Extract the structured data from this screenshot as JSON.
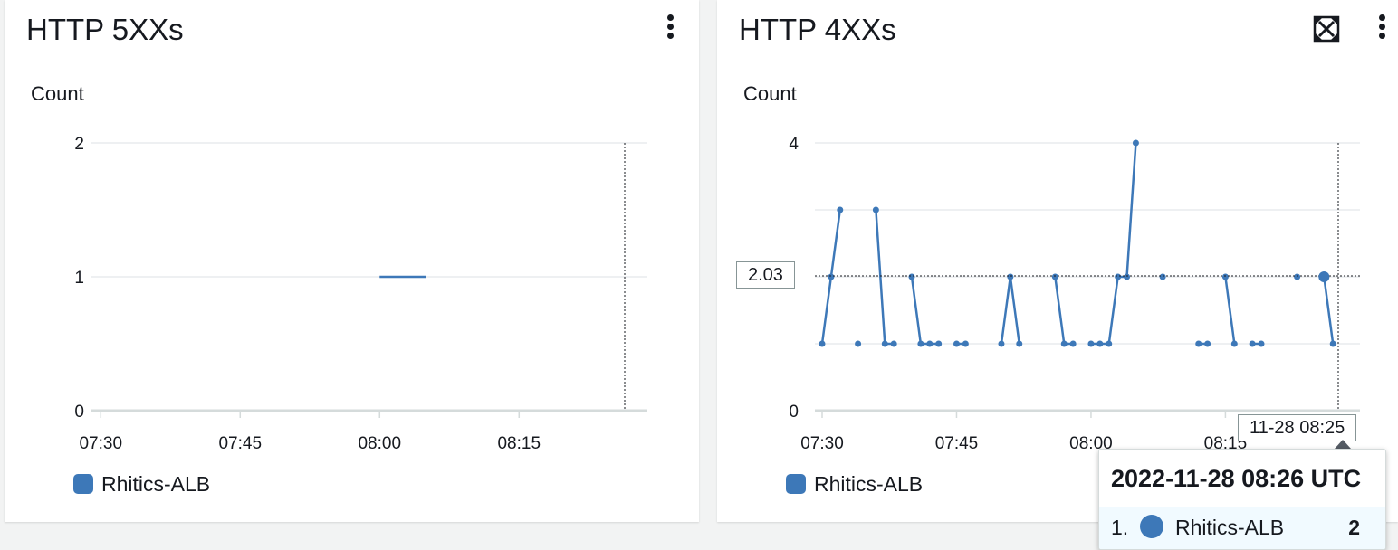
{
  "colors": {
    "series": "#3d78b8",
    "grid": "#e9ebed",
    "axis": "#d5dbdb"
  },
  "widgets": [
    {
      "title": "HTTP 5XXs",
      "y_unit": "Count",
      "menu_icon": "more-vertical-icon",
      "legend": "Rhitics-ALB"
    },
    {
      "title": "HTTP 4XXs",
      "y_unit": "Count",
      "menu_icon": "more-vertical-icon",
      "expand_icon": "expand-icon",
      "legend": "Rhitics-ALB",
      "crosshair": {
        "y_value_label": "2.03",
        "x_time_label": "11-28 08:25"
      },
      "tooltip": {
        "title": "2022-11-28 08:26 UTC",
        "rows": [
          {
            "index": "1.",
            "name": "Rhitics-ALB",
            "value": "2"
          }
        ]
      }
    }
  ],
  "chart_data": [
    {
      "type": "line",
      "title": "HTTP 5XXs",
      "ylabel": "Count",
      "ylim": [
        0,
        2
      ],
      "y_ticks": [
        "0",
        "1",
        "2"
      ],
      "x_ticks": [
        "07:30",
        "07:45",
        "08:00",
        "08:15"
      ],
      "xlim": [
        "07:29",
        "08:29"
      ],
      "series": [
        {
          "name": "Rhitics-ALB",
          "points": [
            {
              "t": "08:00",
              "v": 1
            },
            {
              "t": "08:05",
              "v": 1
            }
          ]
        }
      ]
    },
    {
      "type": "line",
      "title": "HTTP 4XXs",
      "ylabel": "Count",
      "ylim": [
        0,
        4
      ],
      "y_ticks": [
        "0",
        "4"
      ],
      "x_ticks": [
        "07:30",
        "07:45",
        "08:00",
        "08:15"
      ],
      "xlim": [
        "07:30",
        "08:29"
      ],
      "series": [
        {
          "name": "Rhitics-ALB",
          "segments": [
            [
              {
                "t": "07:30",
                "v": 1
              },
              {
                "t": "07:31",
                "v": 2
              },
              {
                "t": "07:32",
                "v": 3
              }
            ],
            [
              {
                "t": "07:34",
                "v": 1
              }
            ],
            [
              {
                "t": "07:36",
                "v": 3
              },
              {
                "t": "07:37",
                "v": 1
              },
              {
                "t": "07:38",
                "v": 1
              }
            ],
            [
              {
                "t": "07:40",
                "v": 2
              },
              {
                "t": "07:41",
                "v": 1
              },
              {
                "t": "07:42",
                "v": 1
              },
              {
                "t": "07:43",
                "v": 1
              }
            ],
            [
              {
                "t": "07:45",
                "v": 1
              },
              {
                "t": "07:46",
                "v": 1
              }
            ],
            [
              {
                "t": "07:50",
                "v": 1
              },
              {
                "t": "07:51",
                "v": 2
              },
              {
                "t": "07:52",
                "v": 1
              }
            ],
            [
              {
                "t": "07:56",
                "v": 2
              },
              {
                "t": "07:57",
                "v": 1
              },
              {
                "t": "07:58",
                "v": 1
              }
            ],
            [
              {
                "t": "08:00",
                "v": 1
              },
              {
                "t": "08:01",
                "v": 1
              },
              {
                "t": "08:02",
                "v": 1
              },
              {
                "t": "08:03",
                "v": 2
              },
              {
                "t": "08:04",
                "v": 2
              },
              {
                "t": "08:05",
                "v": 4
              }
            ],
            [
              {
                "t": "08:08",
                "v": 2
              }
            ],
            [
              {
                "t": "08:12",
                "v": 1
              },
              {
                "t": "08:13",
                "v": 1
              }
            ],
            [
              {
                "t": "08:15",
                "v": 2
              },
              {
                "t": "08:16",
                "v": 1
              }
            ],
            [
              {
                "t": "08:18",
                "v": 1
              },
              {
                "t": "08:19",
                "v": 1
              }
            ],
            [
              {
                "t": "08:23",
                "v": 2
              }
            ],
            [
              {
                "t": "08:26",
                "v": 2
              },
              {
                "t": "08:27",
                "v": 1
              }
            ]
          ]
        }
      ],
      "highlight": {
        "t": "08:26",
        "v": 2
      }
    }
  ]
}
